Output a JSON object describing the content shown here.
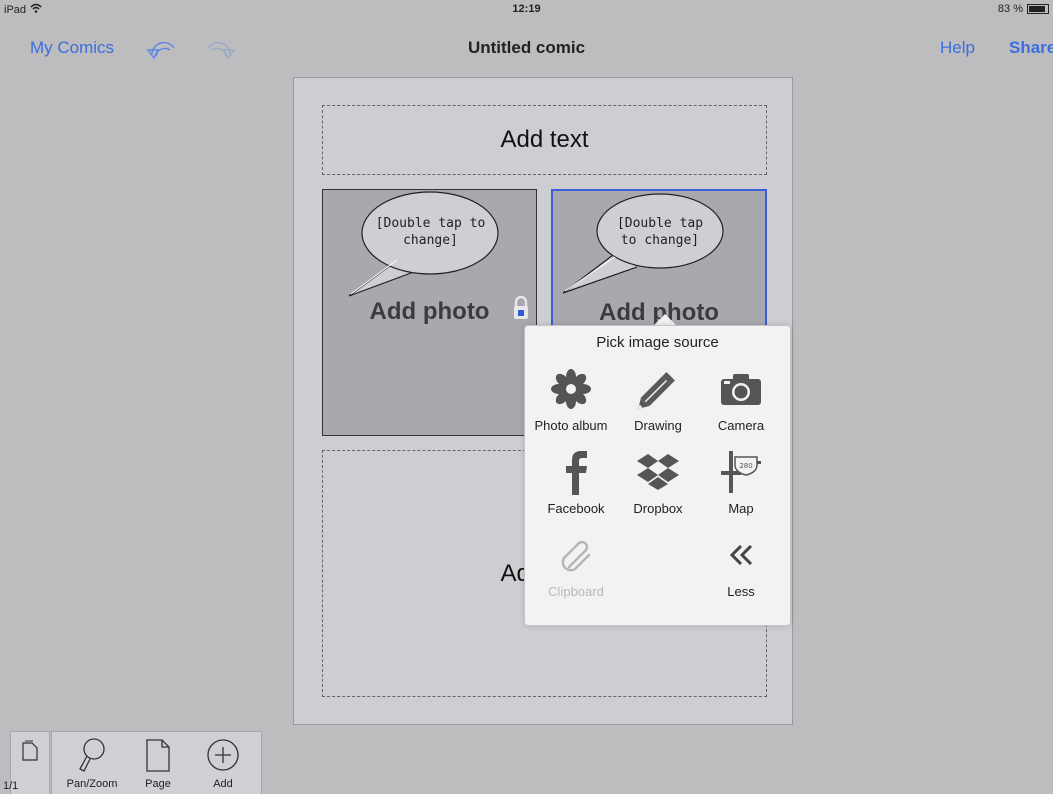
{
  "status": {
    "device": "iPad",
    "time": "12:19",
    "battery": "83 %"
  },
  "nav": {
    "left_link": "My Comics",
    "title": "Untitled comic",
    "help": "Help",
    "share": "Share",
    "undo_icon": "undo-arrow-icon",
    "redo_icon": "redo-arrow-icon"
  },
  "comic": {
    "top_text": "Add text",
    "panels": [
      {
        "bubble": "[Double tap to change]",
        "bubble_line1": "[Double tap to",
        "bubble_line2": "change]",
        "label": "Add photo",
        "locked": true
      },
      {
        "bubble": "[Double tap to change]",
        "bubble_line1": "[Double tap",
        "bubble_line2": "to change]",
        "label": "Add photo",
        "selected": true
      }
    ],
    "bottom_text": "Add text"
  },
  "popover": {
    "title": "Pick image source",
    "items": [
      {
        "label": "Photo album",
        "icon": "flower-icon",
        "enabled": true
      },
      {
        "label": "Drawing",
        "icon": "pencil-icon",
        "enabled": true
      },
      {
        "label": "Camera",
        "icon": "camera-icon",
        "enabled": true
      },
      {
        "label": "Facebook",
        "icon": "facebook-icon",
        "enabled": true
      },
      {
        "label": "Dropbox",
        "icon": "dropbox-icon",
        "enabled": true
      },
      {
        "label": "Map",
        "icon": "map-sign-icon",
        "enabled": true
      },
      {
        "label": "Clipboard",
        "icon": "paperclip-icon",
        "enabled": false
      },
      {
        "label": "Less",
        "icon": "double-chevron-left-icon",
        "enabled": true
      }
    ]
  },
  "toolbar": {
    "page_counter": "1/1",
    "tools": [
      {
        "label": "Pan/Zoom",
        "icon": "magnifier-icon"
      },
      {
        "label": "Page",
        "icon": "page-icon"
      },
      {
        "label": "Add",
        "icon": "plus-circle-icon"
      }
    ]
  },
  "colors": {
    "accent": "#3a6fe0",
    "selection": "#3a5fd6",
    "background": "#bdbcbe"
  }
}
